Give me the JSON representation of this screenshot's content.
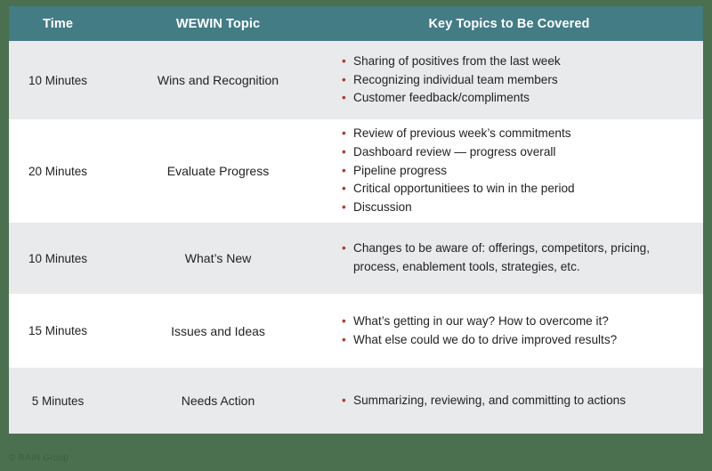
{
  "colors": {
    "border_green": "#4a7050",
    "header_teal": "#447c85",
    "row_alt": "#e8eaec",
    "row_plain": "#ffffff",
    "bullet_red": "#b4382f",
    "text_dark": "#231f20"
  },
  "table": {
    "headers": {
      "time": "Time",
      "topic": "WEWIN Topic",
      "key_topics": "Key Topics to Be Covered"
    },
    "rows": [
      {
        "time": "10 Minutes",
        "topic": "Wins and Recognition",
        "bullets": [
          "Sharing of positives from the last week",
          "Recognizing individual team members",
          "Customer feedback/compliments"
        ]
      },
      {
        "time": "20 Minutes",
        "topic": "Evaluate Progress",
        "bullets": [
          "Review of previous week’s commitments",
          "Dashboard review — progress overall",
          "Pipeline progress",
          "Critical opportunitiees to win in the period",
          "Discussion"
        ]
      },
      {
        "time": "10 Minutes",
        "topic": "What’s New",
        "bullets": [
          "Changes to be aware of: offerings, competitors, pricing, process, enablement tools, strategies, etc."
        ]
      },
      {
        "time": "15 Minutes",
        "topic": "Issues and Ideas",
        "bullets": [
          "What’s getting in our way? How to overcome it?",
          "What else could we do to drive improved results?"
        ]
      },
      {
        "time": "5 Minutes",
        "topic": "Needs Action",
        "bullets": [
          "Summarizing, reviewing, and committing to actions"
        ]
      }
    ]
  },
  "footer": {
    "copyright": "© RAIN Group"
  }
}
